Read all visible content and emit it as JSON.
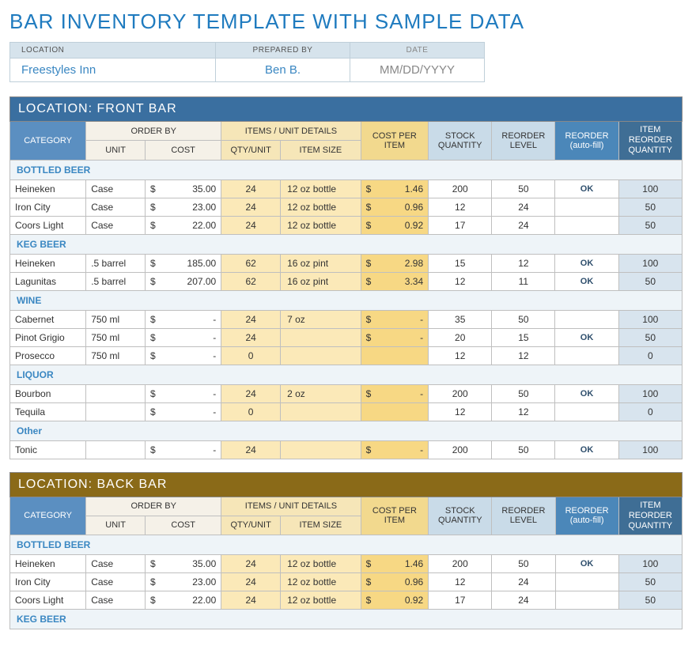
{
  "title": "BAR INVENTORY TEMPLATE WITH SAMPLE DATA",
  "meta": {
    "headers": {
      "location": "LOCATION",
      "prepared": "PREPARED BY",
      "date": "DATE"
    },
    "location": "Freestyles Inn",
    "prepared": "Ben B.",
    "date": "MM/DD/YYYY"
  },
  "columns": {
    "category": "CATEGORY",
    "order_by": "ORDER BY",
    "unit": "UNIT",
    "cost": "COST",
    "items_unit": "ITEMS / UNIT DETAILS",
    "qty_unit": "QTY/UNIT",
    "item_size": "ITEM SIZE",
    "cost_per_item": "COST PER ITEM",
    "stock_qty": "STOCK QUANTITY",
    "reorder_level": "REORDER LEVEL",
    "reorder_auto": "REORDER (auto-fill)",
    "item_reorder_qty": "ITEM REORDER QUANTITY"
  },
  "status_labels": {
    "ok": "OK",
    "reorder": "REORDER"
  },
  "sections": [
    {
      "title": "LOCATION: FRONT BAR",
      "theme": "blue",
      "groups": [
        {
          "name": "BOTTLED BEER",
          "rows": [
            {
              "name": "Heineken",
              "unit": "Case",
              "cost": "35.00",
              "qty": "24",
              "size": "12 oz bottle",
              "per": "1.46",
              "stock": "200",
              "level": "50",
              "status": "ok",
              "irq": "100"
            },
            {
              "name": "Iron City",
              "unit": "Case",
              "cost": "23.00",
              "qty": "24",
              "size": "12 oz bottle",
              "per": "0.96",
              "stock": "12",
              "level": "24",
              "status": "reorder",
              "irq": "50"
            },
            {
              "name": "Coors Light",
              "unit": "Case",
              "cost": "22.00",
              "qty": "24",
              "size": "12 oz bottle",
              "per": "0.92",
              "stock": "17",
              "level": "24",
              "status": "reorder",
              "irq": "50"
            }
          ]
        },
        {
          "name": "KEG BEER",
          "rows": [
            {
              "name": "Heineken",
              "unit": ".5 barrel",
              "cost": "185.00",
              "qty": "62",
              "size": "16 oz pint",
              "per": "2.98",
              "stock": "15",
              "level": "12",
              "status": "ok",
              "irq": "100"
            },
            {
              "name": "Lagunitas",
              "unit": ".5 barrel",
              "cost": "207.00",
              "qty": "62",
              "size": "16 oz pint",
              "per": "3.34",
              "stock": "12",
              "level": "11",
              "status": "ok",
              "irq": "50"
            }
          ]
        },
        {
          "name": "WINE",
          "rows": [
            {
              "name": "Cabernet",
              "unit": "750 ml",
              "cost": "-",
              "qty": "24",
              "size": "7 oz",
              "per": "-",
              "stock": "35",
              "level": "50",
              "status": "reorder",
              "irq": "100"
            },
            {
              "name": "Pinot Grigio",
              "unit": "750 ml",
              "cost": "-",
              "qty": "24",
              "size": "",
              "per": "-",
              "stock": "20",
              "level": "15",
              "status": "ok",
              "irq": "50"
            },
            {
              "name": "Prosecco",
              "unit": "750 ml",
              "cost": "-",
              "qty": "0",
              "size": "",
              "per": "",
              "stock": "12",
              "level": "12",
              "status": "reorder",
              "irq": "0"
            }
          ]
        },
        {
          "name": "LIQUOR",
          "rows": [
            {
              "name": "Bourbon",
              "unit": "",
              "cost": "-",
              "qty": "24",
              "size": "2 oz",
              "per": "-",
              "stock": "200",
              "level": "50",
              "status": "ok",
              "irq": "100"
            },
            {
              "name": "Tequila",
              "unit": "",
              "cost": "-",
              "qty": "0",
              "size": "",
              "per": "",
              "stock": "12",
              "level": "12",
              "status": "reorder",
              "irq": "0"
            }
          ]
        },
        {
          "name": "Other",
          "rows": [
            {
              "name": "Tonic",
              "unit": "",
              "cost": "-",
              "qty": "24",
              "size": "",
              "per": "-",
              "stock": "200",
              "level": "50",
              "status": "ok",
              "irq": "100"
            }
          ]
        }
      ]
    },
    {
      "title": "LOCATION: BACK BAR",
      "theme": "gold",
      "groups": [
        {
          "name": "BOTTLED BEER",
          "rows": [
            {
              "name": "Heineken",
              "unit": "Case",
              "cost": "35.00",
              "qty": "24",
              "size": "12 oz bottle",
              "per": "1.46",
              "stock": "200",
              "level": "50",
              "status": "ok",
              "irq": "100"
            },
            {
              "name": "Iron City",
              "unit": "Case",
              "cost": "23.00",
              "qty": "24",
              "size": "12 oz bottle",
              "per": "0.96",
              "stock": "12",
              "level": "24",
              "status": "reorder",
              "irq": "50"
            },
            {
              "name": "Coors Light",
              "unit": "Case",
              "cost": "22.00",
              "qty": "24",
              "size": "12 oz bottle",
              "per": "0.92",
              "stock": "17",
              "level": "24",
              "status": "reorder",
              "irq": "50"
            }
          ]
        },
        {
          "name": "KEG BEER",
          "rows": []
        }
      ]
    }
  ]
}
